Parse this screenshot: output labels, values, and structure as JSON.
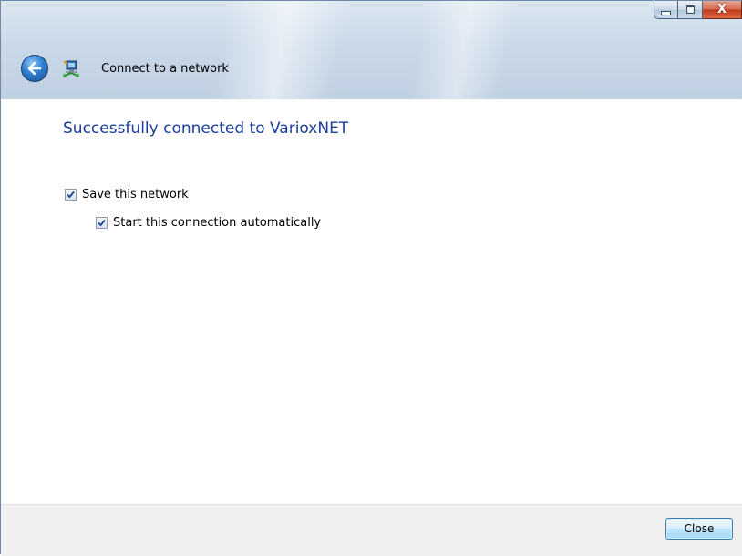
{
  "window": {
    "title": "Connect to a network",
    "caption": {
      "minimize": "",
      "maximize": "",
      "close": "X"
    }
  },
  "main": {
    "heading": "Successfully connected to VarioxNET",
    "options": [
      {
        "label": "Save this network",
        "checked": true
      },
      {
        "label": "Start this connection automatically",
        "checked": true
      }
    ]
  },
  "footer": {
    "close_label": "Close"
  },
  "colors": {
    "heading": "#1a3e9a",
    "footer_bg": "#f0f0f0",
    "titlebar": "#c9d8e8"
  },
  "icons": {
    "back": "back-arrow-icon",
    "network": "network-computer-icon",
    "check": "checkmark-icon"
  }
}
